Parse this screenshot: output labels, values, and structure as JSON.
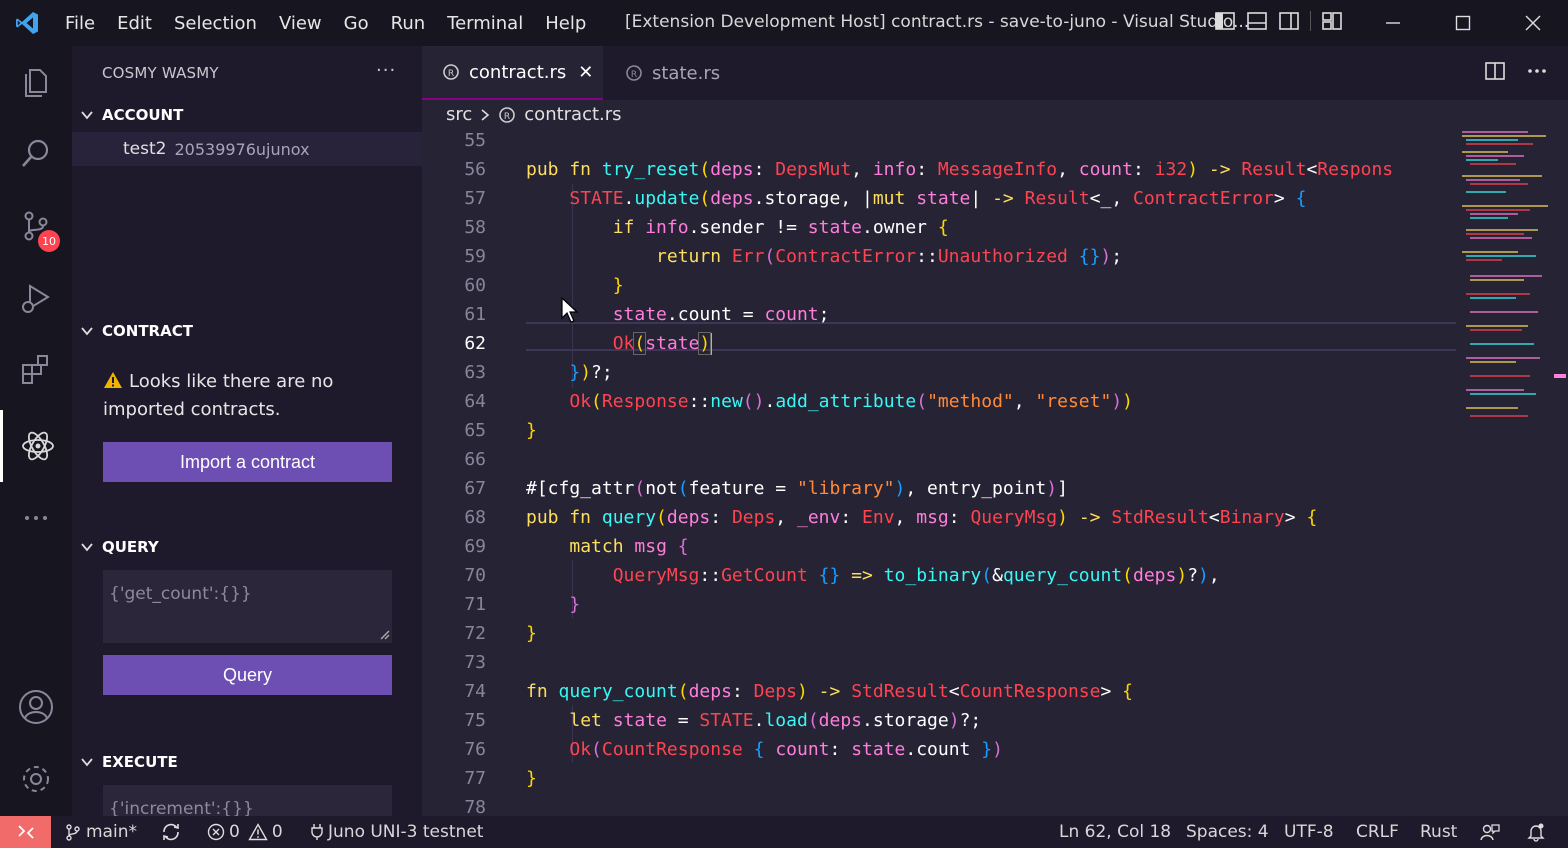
{
  "menu": [
    "File",
    "Edit",
    "Selection",
    "View",
    "Go",
    "Run",
    "Terminal",
    "Help"
  ],
  "window_title": "[Extension Development Host] contract.rs - save-to-juno - Visual Studio...",
  "activity": {
    "scm_badge": "10"
  },
  "sidebar": {
    "title": "COSMY WASMY",
    "more": "···",
    "account": {
      "header": "ACCOUNT",
      "name": "test2",
      "address": "20539976ujunox"
    },
    "contract": {
      "header": "CONTRACT",
      "warning": "Looks like there are no imported contracts.",
      "import_button": "Import a contract"
    },
    "query": {
      "header": "QUERY",
      "placeholder": "{'get_count':{}}",
      "button": "Query"
    },
    "execute": {
      "header": "EXECUTE",
      "placeholder": "{'increment':{}}"
    }
  },
  "tabs": [
    {
      "label": "contract.rs",
      "close": "✕"
    },
    {
      "label": "state.rs"
    }
  ],
  "breadcrumb": {
    "folder": "src",
    "file": "contract.rs"
  },
  "code": {
    "line_numbers": [
      "55",
      "56",
      "57",
      "58",
      "59",
      "60",
      "61",
      "62",
      "63",
      "64",
      "65",
      "66",
      "67",
      "68",
      "69",
      "70",
      "71",
      "72",
      "73",
      "74",
      "75",
      "76",
      "77",
      "78"
    ],
    "current_line": "62"
  },
  "statusbar": {
    "branch": "main*",
    "errors": "0",
    "warnings": "0",
    "network": "Juno UNI-3 testnet",
    "position": "Ln 62, Col 18",
    "spaces": "Spaces: 4",
    "encoding": "UTF-8",
    "eol": "CRLF",
    "language": "Rust"
  },
  "colors": {
    "accent": "#6d4fb3",
    "keyword": "#fede5d",
    "function": "#36f9f6",
    "type": "#fe4450",
    "variable": "#ff7edb",
    "string": "#ff8b39",
    "remote": "#f26b6b"
  }
}
